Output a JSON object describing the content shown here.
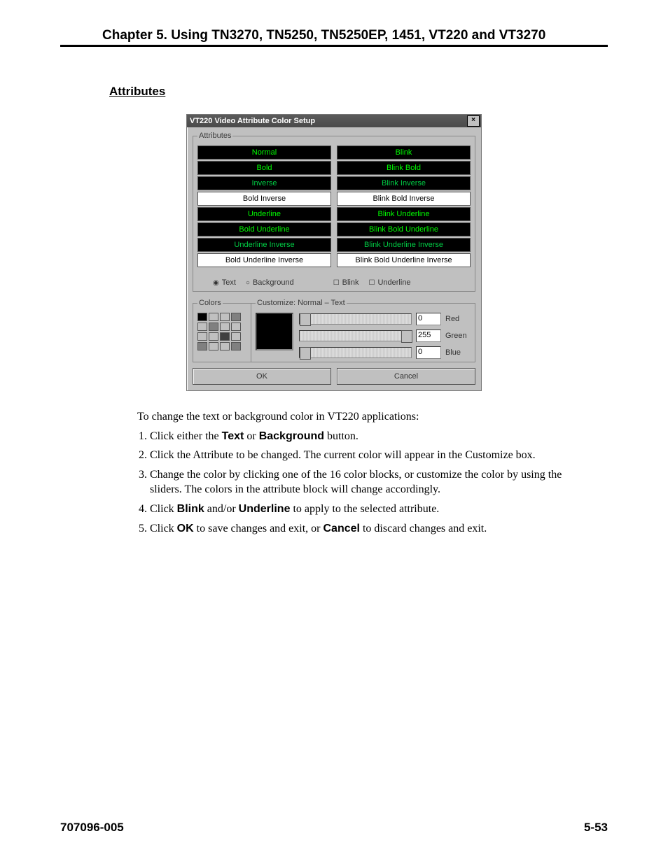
{
  "header": {
    "chapter": "Chapter 5.  Using  TN3270, TN5250, TN5250EP, 1451, VT220 and VT3270"
  },
  "section": {
    "title": "Attributes"
  },
  "dialog": {
    "title": "VT220 Video Attribute Color Setup",
    "close_glyph": "×",
    "attributes_legend": "Attributes",
    "attrs_left": [
      {
        "label": "Normal",
        "bg": "black",
        "fg": "c-green"
      },
      {
        "label": "Bold",
        "bg": "black",
        "fg": "c-green"
      },
      {
        "label": "Inverse",
        "bg": "black",
        "fg": "c-darkg"
      },
      {
        "label": "Bold Inverse",
        "bg": "white",
        "fg": "c-black"
      },
      {
        "label": "Underline",
        "bg": "black",
        "fg": "c-green"
      },
      {
        "label": "Bold Underline",
        "bg": "black",
        "fg": "c-green"
      },
      {
        "label": "Underline Inverse",
        "bg": "black",
        "fg": "c-darkg"
      },
      {
        "label": "Bold Underline Inverse",
        "bg": "white",
        "fg": "c-black"
      }
    ],
    "attrs_right": [
      {
        "label": "Blink",
        "bg": "black",
        "fg": "c-green"
      },
      {
        "label": "Blink Bold",
        "bg": "black",
        "fg": "c-green"
      },
      {
        "label": "Blink Inverse",
        "bg": "black",
        "fg": "c-darkg"
      },
      {
        "label": "Blink Bold Inverse",
        "bg": "white",
        "fg": "c-black"
      },
      {
        "label": "Blink Underline",
        "bg": "black",
        "fg": "c-green"
      },
      {
        "label": "Blink Bold Underline",
        "bg": "black",
        "fg": "c-green"
      },
      {
        "label": "Blink Underline Inverse",
        "bg": "black",
        "fg": "c-darkg"
      },
      {
        "label": "Blink Bold Underline Inverse",
        "bg": "white",
        "fg": "c-black"
      }
    ],
    "radios": {
      "text": "Text",
      "background": "Background",
      "blink": "Blink",
      "underline": "Underline"
    },
    "colors_legend": "Colors",
    "customize_legend": "Customize:  Normal – Text",
    "swatches": [
      "#000000",
      "#c0c0c0",
      "#c0c0c0",
      "#808080",
      "#c0c0c0",
      "#808080",
      "#c0c0c0",
      "#c0c0c0",
      "#c0c0c0",
      "#c0c0c0",
      "#404040",
      "#c0c0c0",
      "#808080",
      "#c0c0c0",
      "#c0c0c0",
      "#808080"
    ],
    "rgb": {
      "red": {
        "val": "0",
        "label": "Red",
        "pos": 0
      },
      "green": {
        "val": "255",
        "label": "Green",
        "pos": 100
      },
      "blue": {
        "val": "0",
        "label": "Blue",
        "pos": 0
      }
    },
    "ok": "OK",
    "cancel": "Cancel"
  },
  "body": {
    "intro": "To change the text or background color in VT220 applications:",
    "steps": [
      {
        "pre": "Click either the ",
        "b1": "Text",
        "mid": " or ",
        "b2": "Background",
        "post": " button."
      },
      {
        "text": "Click the Attribute to be changed. The current color will appear in the Customize box."
      },
      {
        "text": "Change the color by clicking one of the 16 color blocks, or customize the color by using the sliders. The colors in the attribute block will change accordingly."
      },
      {
        "pre": "Click ",
        "b1": "Blink",
        "mid": " and/or ",
        "b2": "Underline",
        "post": " to apply to the selected attribute."
      },
      {
        "pre": "Click ",
        "b1": "OK",
        "mid": " to save changes and exit, or ",
        "b2": "Cancel",
        "post": " to discard changes and exit."
      }
    ]
  },
  "footer": {
    "left": "707096-005",
    "right": "5-53"
  }
}
